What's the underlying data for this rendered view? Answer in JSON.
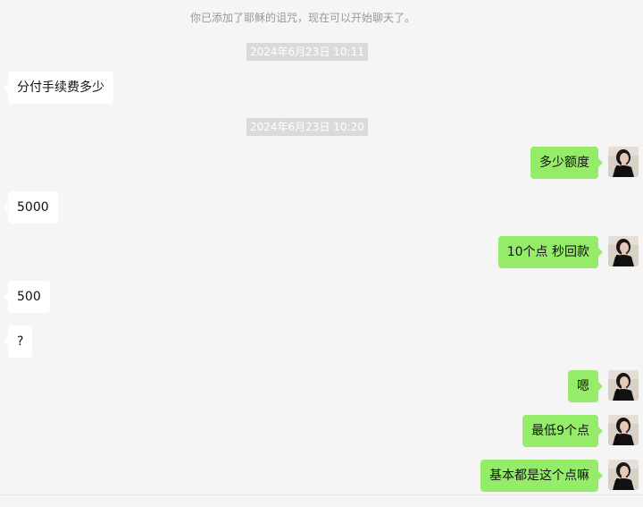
{
  "chat": {
    "system_note": "你已添加了耶稣的诅咒，现在可以开始聊天了。",
    "timestamps": [
      "2024年6月23日 10:11",
      "2024年6月23日 10:20"
    ],
    "messages": [
      {
        "side": "in",
        "text": "分付手续费多少"
      },
      {
        "side": "out",
        "text": "多少额度"
      },
      {
        "side": "in",
        "text": "5000"
      },
      {
        "side": "out",
        "text": "10个点  秒回款"
      },
      {
        "side": "in",
        "text": "500"
      },
      {
        "side": "in",
        "text": "?"
      },
      {
        "side": "out",
        "text": "嗯"
      },
      {
        "side": "out",
        "text": "最低9个点"
      },
      {
        "side": "out",
        "text": "基本都是这个点嘛"
      }
    ]
  },
  "colors": {
    "background": "#f5f5f5",
    "incoming_bubble": "#ffffff",
    "outgoing_bubble": "#95ec69",
    "timestamp_bg": "#dadada",
    "system_text": "#999999"
  },
  "icons": {
    "avatar": "user-avatar-photo"
  }
}
